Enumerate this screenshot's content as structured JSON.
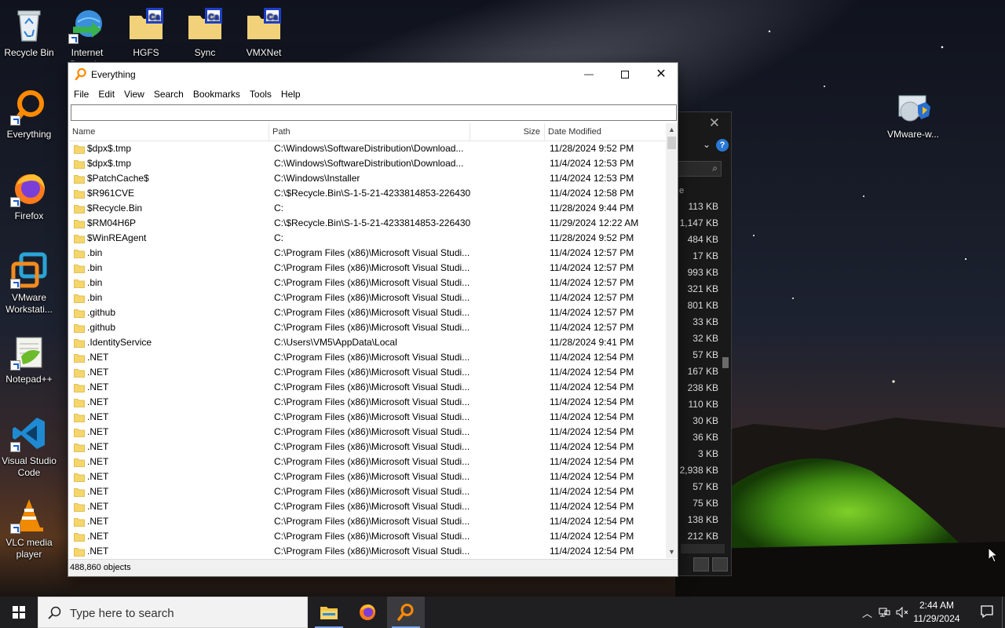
{
  "desktop": {
    "icons_left": [
      {
        "label": "Recycle Bin",
        "icon": "recycle-bin-icon"
      },
      {
        "label": "Internet Downl...",
        "icon": "internet-download-manager-icon"
      },
      {
        "label": "HGFS",
        "icon": "folder-icon"
      },
      {
        "label": "Sync",
        "icon": "folder-icon"
      },
      {
        "label": "VMXNet",
        "icon": "folder-icon"
      },
      {
        "label": "Everything",
        "icon": "everything-icon"
      },
      {
        "label": "Firefox",
        "icon": "firefox-icon"
      },
      {
        "label": "VMware Workstati...",
        "icon": "vmware-icon"
      },
      {
        "label": "Notepad++",
        "icon": "notepadpp-icon"
      },
      {
        "label": "Visual Studio Code",
        "icon": "vscode-icon"
      },
      {
        "label": "VLC media player",
        "icon": "vlc-icon"
      }
    ],
    "icon_right": {
      "label": "VMware-w...",
      "icon": "vmware-installer-icon"
    }
  },
  "background_window": {
    "sizes": [
      "113 KB",
      "1,147 KB",
      "484 KB",
      "17 KB",
      "993 KB",
      "321 KB",
      "801 KB",
      "33 KB",
      "32 KB",
      "57 KB",
      "167 KB",
      "238 KB",
      "110 KB",
      "30 KB",
      "36 KB",
      "3 KB",
      "2,938 KB",
      "57 KB",
      "75 KB",
      "138 KB",
      "212 KB"
    ],
    "column_fragment": "e",
    "help_glyph": "?"
  },
  "everything_window": {
    "title": "Everything",
    "menu": [
      "File",
      "Edit",
      "View",
      "Search",
      "Bookmarks",
      "Tools",
      "Help"
    ],
    "search_value": "",
    "columns": {
      "name": "Name",
      "path": "Path",
      "size": "Size",
      "date": "Date Modified"
    },
    "rows": [
      {
        "name": "$dpx$.tmp",
        "path": "C:\\Windows\\SoftwareDistribution\\Download...",
        "size": "",
        "date": "11/28/2024 9:52 PM"
      },
      {
        "name": "$dpx$.tmp",
        "path": "C:\\Windows\\SoftwareDistribution\\Download...",
        "size": "",
        "date": "11/4/2024 12:53 PM"
      },
      {
        "name": "$PatchCache$",
        "path": "C:\\Windows\\Installer",
        "size": "",
        "date": "11/4/2024 12:53 PM"
      },
      {
        "name": "$R961CVE",
        "path": "C:\\$Recycle.Bin\\S-1-5-21-4233814853-226430...",
        "size": "",
        "date": "11/4/2024 12:58 PM"
      },
      {
        "name": "$Recycle.Bin",
        "path": "C:",
        "size": "",
        "date": "11/28/2024 9:44 PM"
      },
      {
        "name": "$RM04H6P",
        "path": "C:\\$Recycle.Bin\\S-1-5-21-4233814853-226430...",
        "size": "",
        "date": "11/29/2024 12:22 AM"
      },
      {
        "name": "$WinREAgent",
        "path": "C:",
        "size": "",
        "date": "11/28/2024 9:52 PM"
      },
      {
        "name": ".bin",
        "path": "C:\\Program Files (x86)\\Microsoft Visual Studi...",
        "size": "",
        "date": "11/4/2024 12:57 PM"
      },
      {
        "name": ".bin",
        "path": "C:\\Program Files (x86)\\Microsoft Visual Studi...",
        "size": "",
        "date": "11/4/2024 12:57 PM"
      },
      {
        "name": ".bin",
        "path": "C:\\Program Files (x86)\\Microsoft Visual Studi...",
        "size": "",
        "date": "11/4/2024 12:57 PM"
      },
      {
        "name": ".bin",
        "path": "C:\\Program Files (x86)\\Microsoft Visual Studi...",
        "size": "",
        "date": "11/4/2024 12:57 PM"
      },
      {
        "name": ".github",
        "path": "C:\\Program Files (x86)\\Microsoft Visual Studi...",
        "size": "",
        "date": "11/4/2024 12:57 PM"
      },
      {
        "name": ".github",
        "path": "C:\\Program Files (x86)\\Microsoft Visual Studi...",
        "size": "",
        "date": "11/4/2024 12:57 PM"
      },
      {
        "name": ".IdentityService",
        "path": "C:\\Users\\VM5\\AppData\\Local",
        "size": "",
        "date": "11/28/2024 9:41 PM"
      },
      {
        "name": ".NET",
        "path": "C:\\Program Files (x86)\\Microsoft Visual Studi...",
        "size": "",
        "date": "11/4/2024 12:54 PM"
      },
      {
        "name": ".NET",
        "path": "C:\\Program Files (x86)\\Microsoft Visual Studi...",
        "size": "",
        "date": "11/4/2024 12:54 PM"
      },
      {
        "name": ".NET",
        "path": "C:\\Program Files (x86)\\Microsoft Visual Studi...",
        "size": "",
        "date": "11/4/2024 12:54 PM"
      },
      {
        "name": ".NET",
        "path": "C:\\Program Files (x86)\\Microsoft Visual Studi...",
        "size": "",
        "date": "11/4/2024 12:54 PM"
      },
      {
        "name": ".NET",
        "path": "C:\\Program Files (x86)\\Microsoft Visual Studi...",
        "size": "",
        "date": "11/4/2024 12:54 PM"
      },
      {
        "name": ".NET",
        "path": "C:\\Program Files (x86)\\Microsoft Visual Studi...",
        "size": "",
        "date": "11/4/2024 12:54 PM"
      },
      {
        "name": ".NET",
        "path": "C:\\Program Files (x86)\\Microsoft Visual Studi...",
        "size": "",
        "date": "11/4/2024 12:54 PM"
      },
      {
        "name": ".NET",
        "path": "C:\\Program Files (x86)\\Microsoft Visual Studi...",
        "size": "",
        "date": "11/4/2024 12:54 PM"
      },
      {
        "name": ".NET",
        "path": "C:\\Program Files (x86)\\Microsoft Visual Studi...",
        "size": "",
        "date": "11/4/2024 12:54 PM"
      },
      {
        "name": ".NET",
        "path": "C:\\Program Files (x86)\\Microsoft Visual Studi...",
        "size": "",
        "date": "11/4/2024 12:54 PM"
      },
      {
        "name": ".NET",
        "path": "C:\\Program Files (x86)\\Microsoft Visual Studi...",
        "size": "",
        "date": "11/4/2024 12:54 PM"
      },
      {
        "name": ".NET",
        "path": "C:\\Program Files (x86)\\Microsoft Visual Studi...",
        "size": "",
        "date": "11/4/2024 12:54 PM"
      },
      {
        "name": ".NET",
        "path": "C:\\Program Files (x86)\\Microsoft Visual Studi...",
        "size": "",
        "date": "11/4/2024 12:54 PM"
      },
      {
        "name": ".NET",
        "path": "C:\\Program Files (x86)\\Microsoft Visual Studi...",
        "size": "",
        "date": "11/4/2024 12:54 PM"
      }
    ],
    "status": "488,860 objects"
  },
  "taskbar": {
    "search_placeholder": "Type here to search",
    "apps": [
      "file-explorer-icon",
      "firefox-icon",
      "everything-icon"
    ],
    "time": "2:44 AM",
    "date": "11/29/2024"
  },
  "colors": {
    "folder": "#f5d66b",
    "taskbar": "#1f1f22",
    "everything_orange": "#ff8a00"
  }
}
